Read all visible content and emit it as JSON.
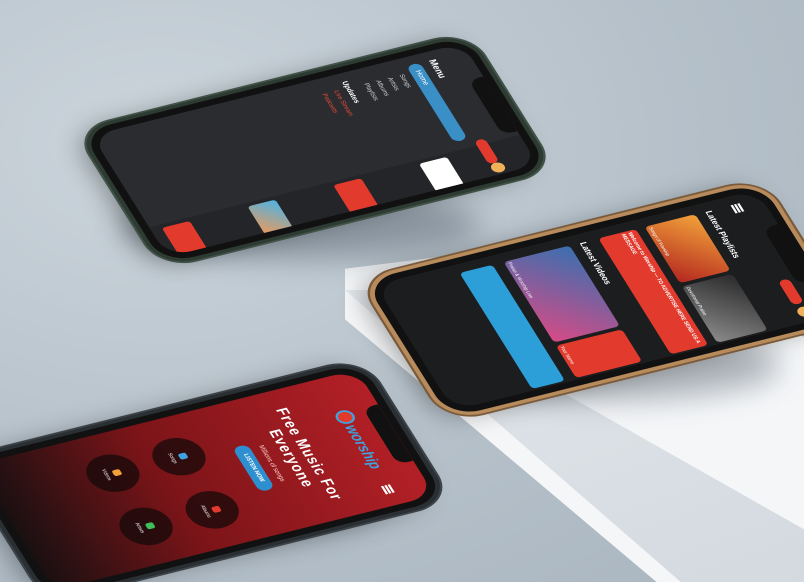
{
  "menu_screen": {
    "title": "Menu",
    "home": "Home",
    "items": [
      "Songs",
      "Artists",
      "Albums",
      "Playlists"
    ],
    "updates_heading": "Updates",
    "updates_items": [
      "Live Stream",
      "Podcasts"
    ]
  },
  "latest_screen": {
    "playlists_heading": "Latest Playlists",
    "playlist_labels": [
      "Songs of Worship",
      "Devotional Praise"
    ],
    "videos_heading": "Latest Videos",
    "video_labels": [
      "Praise & Worship Live",
      "Your Name"
    ],
    "ad_text": "Welcome to Worship — TO ADVERTISE HERE SEND US A MESSAGE"
  },
  "home_screen": {
    "heading": "Free Music For Everyone",
    "subheading": "Millions of songs",
    "listen_button": "LISTEN NOW",
    "circles": [
      "Songs",
      "Albums",
      "Videos",
      "Artists"
    ],
    "logo_text": "worship"
  },
  "colors": {
    "brand_red": "#e23b2e",
    "brand_blue": "#3ea3e0",
    "screen_dark": "#1c1d1f",
    "background": "#b9c4cd"
  }
}
